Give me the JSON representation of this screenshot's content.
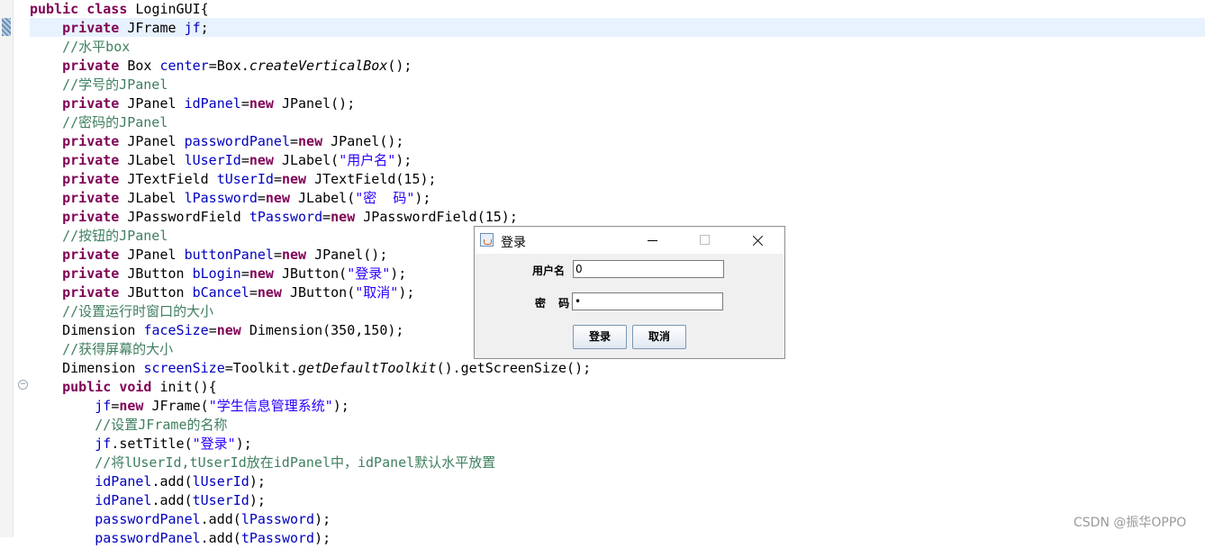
{
  "editor": {
    "lines": [
      [
        {
          "t": "public",
          "c": "kw"
        },
        {
          "t": " "
        },
        {
          "t": "class",
          "c": "kw"
        },
        {
          "t": " LoginGUI{"
        }
      ],
      [
        {
          "t": "    "
        },
        {
          "t": "private",
          "c": "kw"
        },
        {
          "t": " JFrame "
        },
        {
          "t": "jf",
          "c": "fld"
        },
        {
          "t": ";"
        }
      ],
      [
        {
          "t": "    "
        },
        {
          "t": "//水平box",
          "c": "cmt"
        }
      ],
      [
        {
          "t": "    "
        },
        {
          "t": "private",
          "c": "kw"
        },
        {
          "t": " Box "
        },
        {
          "t": "center",
          "c": "fld"
        },
        {
          "t": "=Box."
        },
        {
          "t": "createVerticalBox",
          "c": "ita"
        },
        {
          "t": "();"
        }
      ],
      [
        {
          "t": "    "
        },
        {
          "t": "//学号的JPanel",
          "c": "cmt"
        }
      ],
      [
        {
          "t": "    "
        },
        {
          "t": "private",
          "c": "kw"
        },
        {
          "t": " JPanel "
        },
        {
          "t": "idPanel",
          "c": "fld"
        },
        {
          "t": "="
        },
        {
          "t": "new",
          "c": "kw"
        },
        {
          "t": " JPanel();"
        }
      ],
      [
        {
          "t": "    "
        },
        {
          "t": "//密码的JPanel",
          "c": "cmt"
        }
      ],
      [
        {
          "t": "    "
        },
        {
          "t": "private",
          "c": "kw"
        },
        {
          "t": " JPanel "
        },
        {
          "t": "passwordPanel",
          "c": "fld"
        },
        {
          "t": "="
        },
        {
          "t": "new",
          "c": "kw"
        },
        {
          "t": " JPanel();"
        }
      ],
      [
        {
          "t": "    "
        },
        {
          "t": "private",
          "c": "kw"
        },
        {
          "t": " JLabel "
        },
        {
          "t": "lUserId",
          "c": "fld"
        },
        {
          "t": "="
        },
        {
          "t": "new",
          "c": "kw"
        },
        {
          "t": " JLabel("
        },
        {
          "t": "\"用户名\"",
          "c": "str"
        },
        {
          "t": ");"
        }
      ],
      [
        {
          "t": "    "
        },
        {
          "t": "private",
          "c": "kw"
        },
        {
          "t": " JTextField "
        },
        {
          "t": "tUserId",
          "c": "fld"
        },
        {
          "t": "="
        },
        {
          "t": "new",
          "c": "kw"
        },
        {
          "t": " JTextField(15);"
        }
      ],
      [
        {
          "t": "    "
        },
        {
          "t": "private",
          "c": "kw"
        },
        {
          "t": " JLabel "
        },
        {
          "t": "lPassword",
          "c": "fld"
        },
        {
          "t": "="
        },
        {
          "t": "new",
          "c": "kw"
        },
        {
          "t": " JLabel("
        },
        {
          "t": "\"密  码\"",
          "c": "str"
        },
        {
          "t": ");"
        }
      ],
      [
        {
          "t": "    "
        },
        {
          "t": "private",
          "c": "kw"
        },
        {
          "t": " JPasswordField "
        },
        {
          "t": "tPassword",
          "c": "fld"
        },
        {
          "t": "="
        },
        {
          "t": "new",
          "c": "kw"
        },
        {
          "t": " JPasswordField(15);"
        }
      ],
      [
        {
          "t": "    "
        },
        {
          "t": "//按钮的JPanel",
          "c": "cmt"
        }
      ],
      [
        {
          "t": "    "
        },
        {
          "t": "private",
          "c": "kw"
        },
        {
          "t": " JPanel "
        },
        {
          "t": "buttonPanel",
          "c": "fld"
        },
        {
          "t": "="
        },
        {
          "t": "new",
          "c": "kw"
        },
        {
          "t": " JPanel();"
        }
      ],
      [
        {
          "t": "    "
        },
        {
          "t": "private",
          "c": "kw"
        },
        {
          "t": " JButton "
        },
        {
          "t": "bLogin",
          "c": "fld"
        },
        {
          "t": "="
        },
        {
          "t": "new",
          "c": "kw"
        },
        {
          "t": " JButton("
        },
        {
          "t": "\"登录\"",
          "c": "str"
        },
        {
          "t": ");"
        }
      ],
      [
        {
          "t": "    "
        },
        {
          "t": "private",
          "c": "kw"
        },
        {
          "t": " JButton "
        },
        {
          "t": "bCancel",
          "c": "fld"
        },
        {
          "t": "="
        },
        {
          "t": "new",
          "c": "kw"
        },
        {
          "t": " JButton("
        },
        {
          "t": "\"取消\"",
          "c": "str"
        },
        {
          "t": ");"
        }
      ],
      [
        {
          "t": "    "
        },
        {
          "t": "//设置运行时窗口的大小",
          "c": "cmt"
        }
      ],
      [
        {
          "t": "    Dimension "
        },
        {
          "t": "faceSize",
          "c": "fld"
        },
        {
          "t": "="
        },
        {
          "t": "new",
          "c": "kw"
        },
        {
          "t": " Dimension(350,150);"
        }
      ],
      [
        {
          "t": "    "
        },
        {
          "t": "//获得屏幕的大小",
          "c": "cmt"
        }
      ],
      [
        {
          "t": "    Dimension "
        },
        {
          "t": "screenSize",
          "c": "fld"
        },
        {
          "t": "=Toolkit."
        },
        {
          "t": "getDefaultToolkit",
          "c": "ita"
        },
        {
          "t": "().getScreenSize();"
        }
      ],
      [
        {
          "t": "    "
        },
        {
          "t": "public",
          "c": "kw"
        },
        {
          "t": " "
        },
        {
          "t": "void",
          "c": "kw"
        },
        {
          "t": " init(){"
        }
      ],
      [
        {
          "t": "        "
        },
        {
          "t": "jf",
          "c": "fld"
        },
        {
          "t": "="
        },
        {
          "t": "new",
          "c": "kw"
        },
        {
          "t": " JFrame("
        },
        {
          "t": "\"学生信息管理系统\"",
          "c": "str"
        },
        {
          "t": ");"
        }
      ],
      [
        {
          "t": "        "
        },
        {
          "t": "//设置JFrame的名称",
          "c": "cmt"
        }
      ],
      [
        {
          "t": "        "
        },
        {
          "t": "jf",
          "c": "fld"
        },
        {
          "t": ".setTitle("
        },
        {
          "t": "\"登录\"",
          "c": "str"
        },
        {
          "t": ");"
        }
      ],
      [
        {
          "t": "        "
        },
        {
          "t": "//将lUserId,tUserId放在idPanel中，idPanel默认水平放置",
          "c": "cmt"
        }
      ],
      [
        {
          "t": "        "
        },
        {
          "t": "idPanel",
          "c": "fld"
        },
        {
          "t": ".add("
        },
        {
          "t": "lUserId",
          "c": "fld"
        },
        {
          "t": ");"
        }
      ],
      [
        {
          "t": "        "
        },
        {
          "t": "idPanel",
          "c": "fld"
        },
        {
          "t": ".add("
        },
        {
          "t": "tUserId",
          "c": "fld"
        },
        {
          "t": ");"
        }
      ],
      [
        {
          "t": "        "
        },
        {
          "t": "passwordPanel",
          "c": "fld"
        },
        {
          "t": ".add("
        },
        {
          "t": "lPassword",
          "c": "fld"
        },
        {
          "t": ");"
        }
      ],
      [
        {
          "t": "        "
        },
        {
          "t": "passwordPanel",
          "c": "fld"
        },
        {
          "t": ".add("
        },
        {
          "t": "tPassword",
          "c": "fld"
        },
        {
          "t": ");"
        }
      ]
    ],
    "colors": {
      "keyword": "#7f0055",
      "field": "#0000c0",
      "comment": "#3f7f5f",
      "string": "#2a00ff",
      "current_line": "#e8f2fe"
    }
  },
  "dialog": {
    "title": "登录",
    "icon": "java-coffee-icon",
    "user_label": "用户名",
    "user_value": "0",
    "password_label": "密 码",
    "password_value": "•",
    "login_button": "登录",
    "cancel_button": "取消"
  },
  "watermark": "CSDN @振华OPPO"
}
